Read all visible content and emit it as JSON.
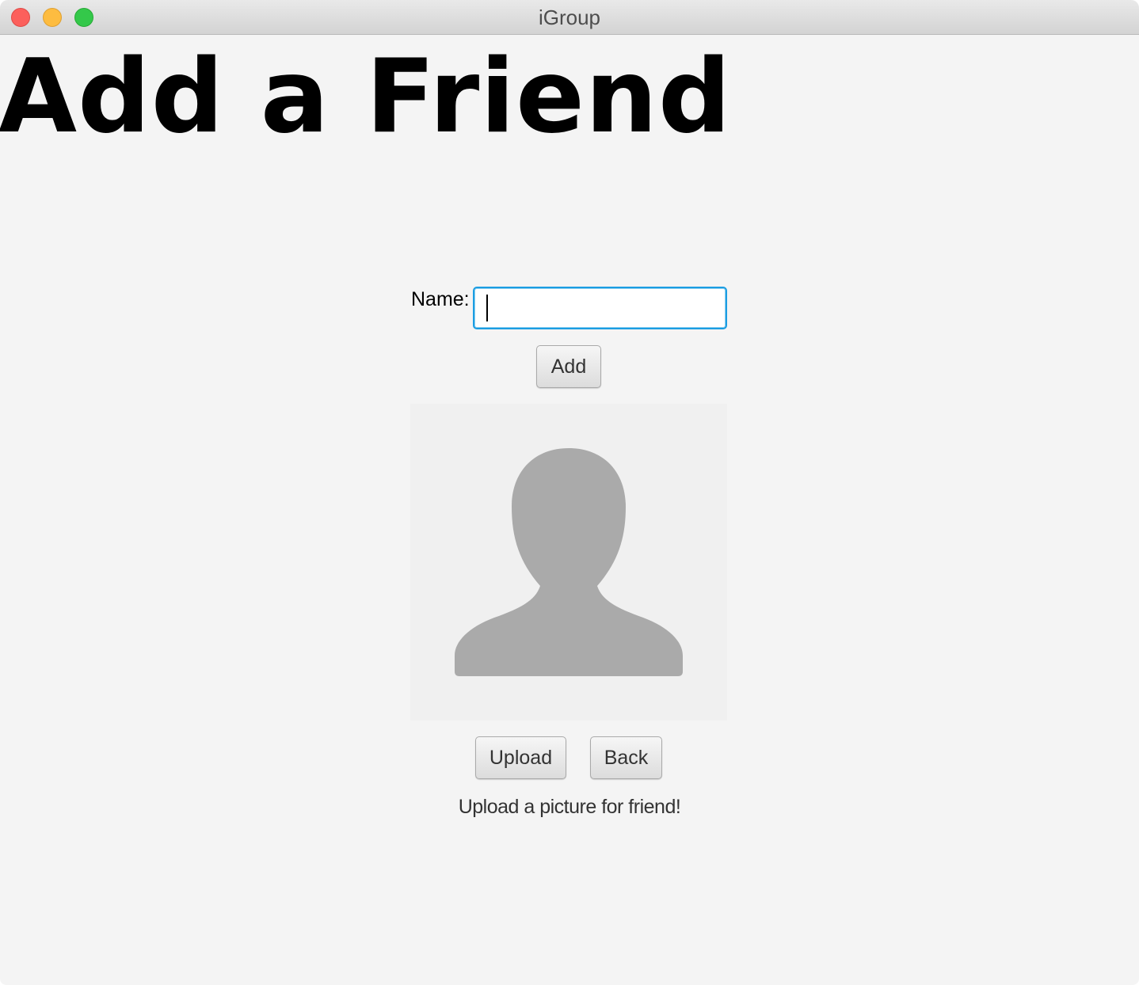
{
  "window": {
    "title": "iGroup"
  },
  "page": {
    "heading": "Add a Friend"
  },
  "form": {
    "name_label": "Name:",
    "name_value": "",
    "add_label": "Add"
  },
  "picture": {
    "icon": "person-silhouette-icon",
    "upload_label": "Upload",
    "back_label": "Back",
    "status": "Upload a picture for friend!"
  },
  "colors": {
    "focus_ring": "#1b9de2",
    "placeholder_silhouette": "#aaaaaa"
  }
}
